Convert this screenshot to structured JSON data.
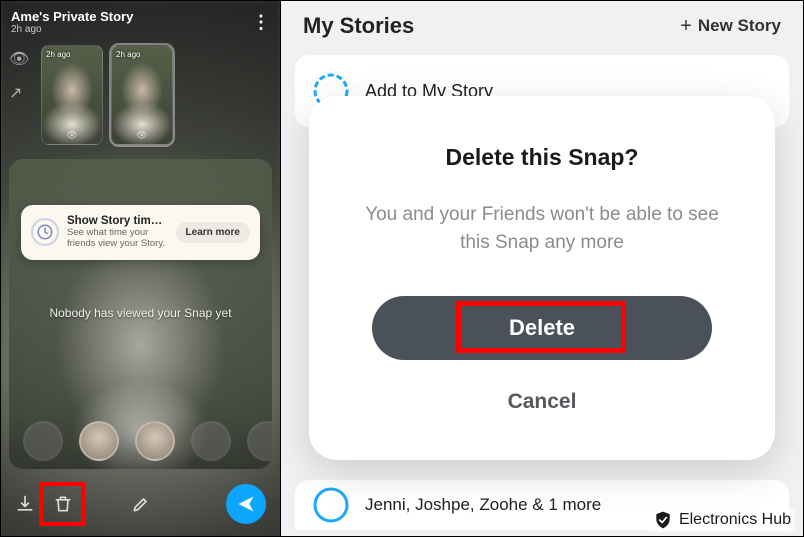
{
  "left": {
    "title": "Ame's Private Story",
    "subtime": "2h ago",
    "thumbs": [
      {
        "time": "2h ago"
      },
      {
        "time": "2h ago"
      }
    ],
    "tip": {
      "title": "Show Story time…",
      "subtitle": "See what time your friends view your Story.",
      "button": "Learn more"
    },
    "nobody_text": "Nobody has viewed your Snap yet"
  },
  "right": {
    "header_title": "My Stories",
    "new_story_label": "New Story",
    "add_row_label": "Add to My Story",
    "bottom_row_label": "Jenni, Joshpe, Zoohe & 1 more"
  },
  "modal": {
    "title": "Delete this Snap?",
    "message": "You and your Friends won't be able to see this Snap any more",
    "delete_label": "Delete",
    "cancel_label": "Cancel"
  },
  "watermark": {
    "text": "Electronics Hub"
  },
  "colors": {
    "accent_blue": "#0ea5ff",
    "highlight_red": "#ff0000",
    "modal_button": "#4b5158",
    "ring_blue": "#1fa8ff"
  }
}
